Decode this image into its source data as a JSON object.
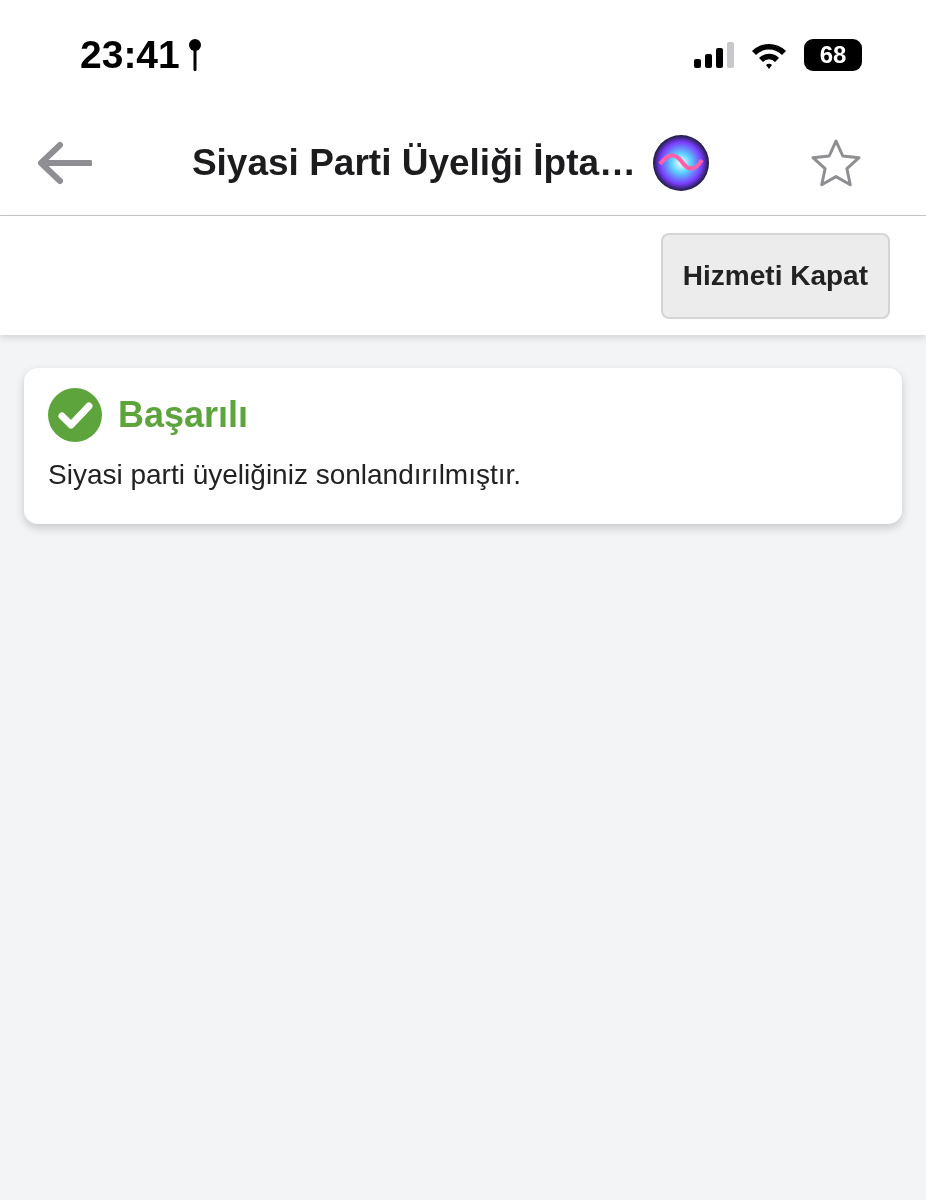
{
  "status_bar": {
    "time": "23:41",
    "battery": "68"
  },
  "header": {
    "title": "Siyasi Parti Üyeliği İpta…",
    "favorited": false
  },
  "toolbar": {
    "buttons": [
      "Hizmeti Kapat"
    ]
  },
  "alert": {
    "kind": "success",
    "title": "Başarılı",
    "message": "Siyasi parti üyeliğiniz sonlandırılmıştır."
  }
}
